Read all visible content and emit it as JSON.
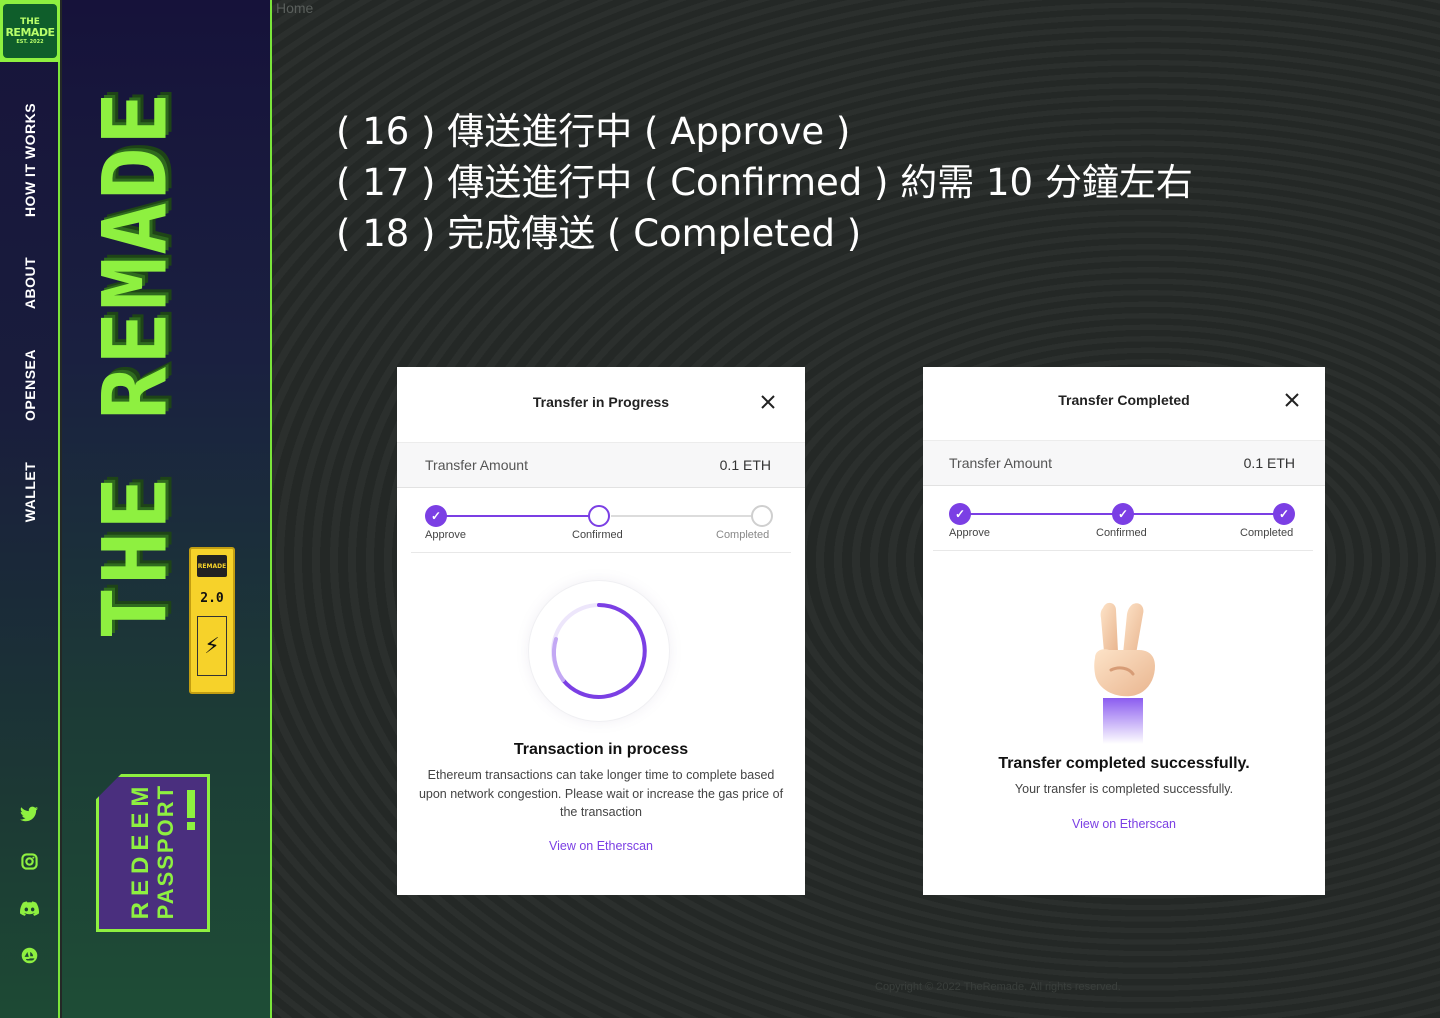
{
  "nav": {
    "logo_line1": "THE",
    "logo_line2": "REMADE",
    "logo_line3": "EST. 2022",
    "items": [
      {
        "label": "HOW IT WORKS"
      },
      {
        "label": "ABOUT"
      },
      {
        "label": "OPENSEA"
      },
      {
        "label": "WALLET"
      }
    ],
    "socials": [
      "twitter-icon",
      "instagram-icon",
      "discord-icon",
      "opensea-icon"
    ]
  },
  "sidebar": {
    "brand": "THE REMADE",
    "passport_card_version": "2.0",
    "passport_card_logo": "REMADE",
    "redeem_line1": "REDEEM",
    "redeem_line2": "PASSPORT"
  },
  "breadcrumb": "Home",
  "instructions": [
    "( 16 ) 傳送進行中 ( Approve )",
    "( 17 ) 傳送進行中 ( Confirmed ) 約需 10 分鐘左右",
    "( 18 ) 完成傳送 ( Completed )"
  ],
  "modal_progress": {
    "title": "Transfer in Progress",
    "amount_label": "Transfer Amount",
    "amount_value": "0.1 ETH",
    "steps": [
      "Approve",
      "Confirmed",
      "Completed"
    ],
    "heading": "Transaction in process",
    "description": "Ethereum transactions can take longer time to complete based upon network congestion. Please wait or increase the gas price of the transaction",
    "link": "View on Etherscan"
  },
  "modal_completed": {
    "title": "Transfer Completed",
    "amount_label": "Transfer Amount",
    "amount_value": "0.1 ETH",
    "steps": [
      "Approve",
      "Confirmed",
      "Completed"
    ],
    "heading": "Transfer completed successfully.",
    "description": "Your transfer is completed successfully.",
    "link": "View on Etherscan"
  },
  "footer": {
    "copyright": "Copyright © 2022 TheRemade. All rights reserved."
  },
  "colors": {
    "accent_green": "#8ef040",
    "accent_purple": "#7b3fe4",
    "passport_purple": "#4a2f7e"
  }
}
